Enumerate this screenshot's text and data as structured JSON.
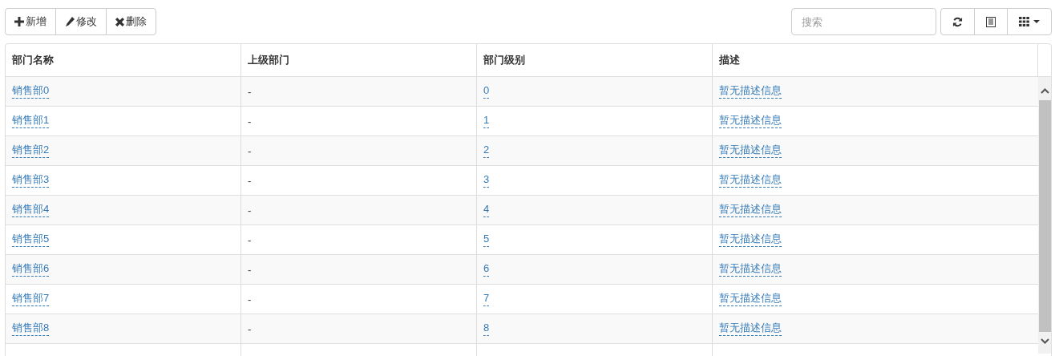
{
  "toolbar": {
    "buttons": [
      {
        "kind": "add",
        "label": "新增"
      },
      {
        "kind": "edit",
        "label": "修改"
      },
      {
        "kind": "delete",
        "label": "删除"
      }
    ]
  },
  "search": {
    "placeholder": "搜索"
  },
  "view_buttons": [
    {
      "kind": "refresh"
    },
    {
      "kind": "toggle"
    },
    {
      "kind": "columns"
    }
  ],
  "table": {
    "columns": [
      "部门名称",
      "上级部门",
      "部门级别",
      "描述"
    ],
    "rows": [
      {
        "name": "销售部0",
        "parent": "-",
        "level": "0",
        "description": "暂无描述信息"
      },
      {
        "name": "销售部1",
        "parent": "-",
        "level": "1",
        "description": "暂无描述信息"
      },
      {
        "name": "销售部2",
        "parent": "-",
        "level": "2",
        "description": "暂无描述信息"
      },
      {
        "name": "销售部3",
        "parent": "-",
        "level": "3",
        "description": "暂无描述信息"
      },
      {
        "name": "销售部4",
        "parent": "-",
        "level": "4",
        "description": "暂无描述信息"
      },
      {
        "name": "销售部5",
        "parent": "-",
        "level": "5",
        "description": "暂无描述信息"
      },
      {
        "name": "销售部6",
        "parent": "-",
        "level": "6",
        "description": "暂无描述信息"
      },
      {
        "name": "销售部7",
        "parent": "-",
        "level": "7",
        "description": "暂无描述信息"
      },
      {
        "name": "销售部8",
        "parent": "-",
        "level": "8",
        "description": "暂无描述信息"
      }
    ]
  }
}
